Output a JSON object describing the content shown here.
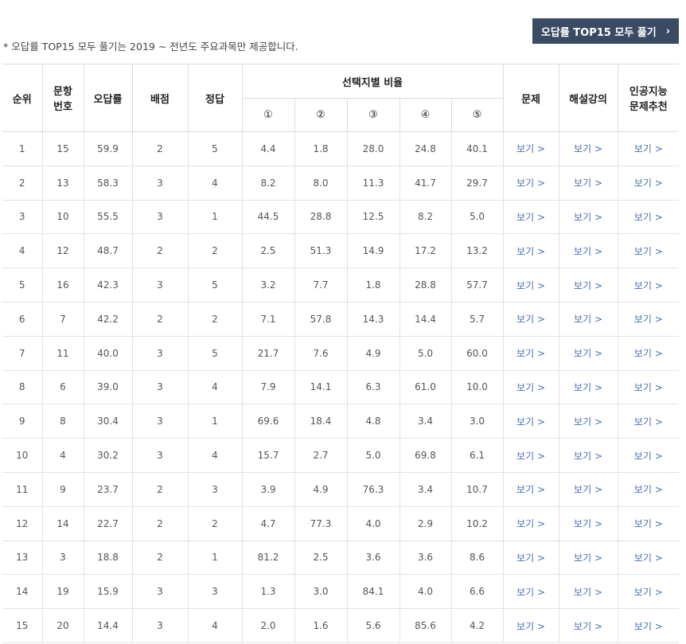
{
  "note": "* 오답률 TOP15 모두 풀기는 2019 ~ 전년도 주요과목만 제공합니다.",
  "solve_button": {
    "label": "오답률 TOP15 모두 풀기",
    "icon": "chevron-right-icon",
    "chev": "›"
  },
  "headers": {
    "rank": "순위",
    "qnum": "문항\n번호",
    "wrong_rate": "오답률",
    "points": "배점",
    "answer": "정답",
    "choice_ratio": "선택지별 비율",
    "choices": [
      "①",
      "②",
      "③",
      "④",
      "⑤"
    ],
    "problem": "문제",
    "lecture": "해설강의",
    "ai": "인공지능\n문제추천"
  },
  "link_label": "보기 >",
  "rows": [
    {
      "rank": "1",
      "qnum": "15",
      "rate": "59.9",
      "points": "2",
      "answer": "5",
      "c": [
        "4.4",
        "1.8",
        "28.0",
        "24.8",
        "40.1"
      ]
    },
    {
      "rank": "2",
      "qnum": "13",
      "rate": "58.3",
      "points": "3",
      "answer": "4",
      "c": [
        "8.2",
        "8.0",
        "11.3",
        "41.7",
        "29.7"
      ]
    },
    {
      "rank": "3",
      "qnum": "10",
      "rate": "55.5",
      "points": "3",
      "answer": "1",
      "c": [
        "44.5",
        "28.8",
        "12.5",
        "8.2",
        "5.0"
      ]
    },
    {
      "rank": "4",
      "qnum": "12",
      "rate": "48.7",
      "points": "2",
      "answer": "2",
      "c": [
        "2.5",
        "51.3",
        "14.9",
        "17.2",
        "13.2"
      ]
    },
    {
      "rank": "5",
      "qnum": "16",
      "rate": "42.3",
      "points": "3",
      "answer": "5",
      "c": [
        "3.2",
        "7.7",
        "1.8",
        "28.8",
        "57.7"
      ]
    },
    {
      "rank": "6",
      "qnum": "7",
      "rate": "42.2",
      "points": "2",
      "answer": "2",
      "c": [
        "7.1",
        "57.8",
        "14.3",
        "14.4",
        "5.7"
      ]
    },
    {
      "rank": "7",
      "qnum": "11",
      "rate": "40.0",
      "points": "3",
      "answer": "5",
      "c": [
        "21.7",
        "7.6",
        "4.9",
        "5.0",
        "60.0"
      ]
    },
    {
      "rank": "8",
      "qnum": "6",
      "rate": "39.0",
      "points": "3",
      "answer": "4",
      "c": [
        "7.9",
        "14.1",
        "6.3",
        "61.0",
        "10.0"
      ]
    },
    {
      "rank": "9",
      "qnum": "8",
      "rate": "30.4",
      "points": "3",
      "answer": "1",
      "c": [
        "69.6",
        "18.4",
        "4.8",
        "3.4",
        "3.0"
      ]
    },
    {
      "rank": "10",
      "qnum": "4",
      "rate": "30.2",
      "points": "3",
      "answer": "4",
      "c": [
        "15.7",
        "2.7",
        "5.0",
        "69.8",
        "6.1"
      ]
    },
    {
      "rank": "11",
      "qnum": "9",
      "rate": "23.7",
      "points": "2",
      "answer": "3",
      "c": [
        "3.9",
        "4.9",
        "76.3",
        "3.4",
        "10.7"
      ]
    },
    {
      "rank": "12",
      "qnum": "14",
      "rate": "22.7",
      "points": "2",
      "answer": "2",
      "c": [
        "4.7",
        "77.3",
        "4.0",
        "2.9",
        "10.2"
      ]
    },
    {
      "rank": "13",
      "qnum": "3",
      "rate": "18.8",
      "points": "2",
      "answer": "1",
      "c": [
        "81.2",
        "2.5",
        "3.6",
        "3.6",
        "8.6"
      ]
    },
    {
      "rank": "14",
      "qnum": "19",
      "rate": "15.9",
      "points": "3",
      "answer": "3",
      "c": [
        "1.3",
        "3.0",
        "84.1",
        "4.0",
        "6.6"
      ]
    },
    {
      "rank": "15",
      "qnum": "20",
      "rate": "14.4",
      "points": "3",
      "answer": "4",
      "c": [
        "2.0",
        "1.6",
        "5.6",
        "85.6",
        "4.2"
      ]
    }
  ]
}
